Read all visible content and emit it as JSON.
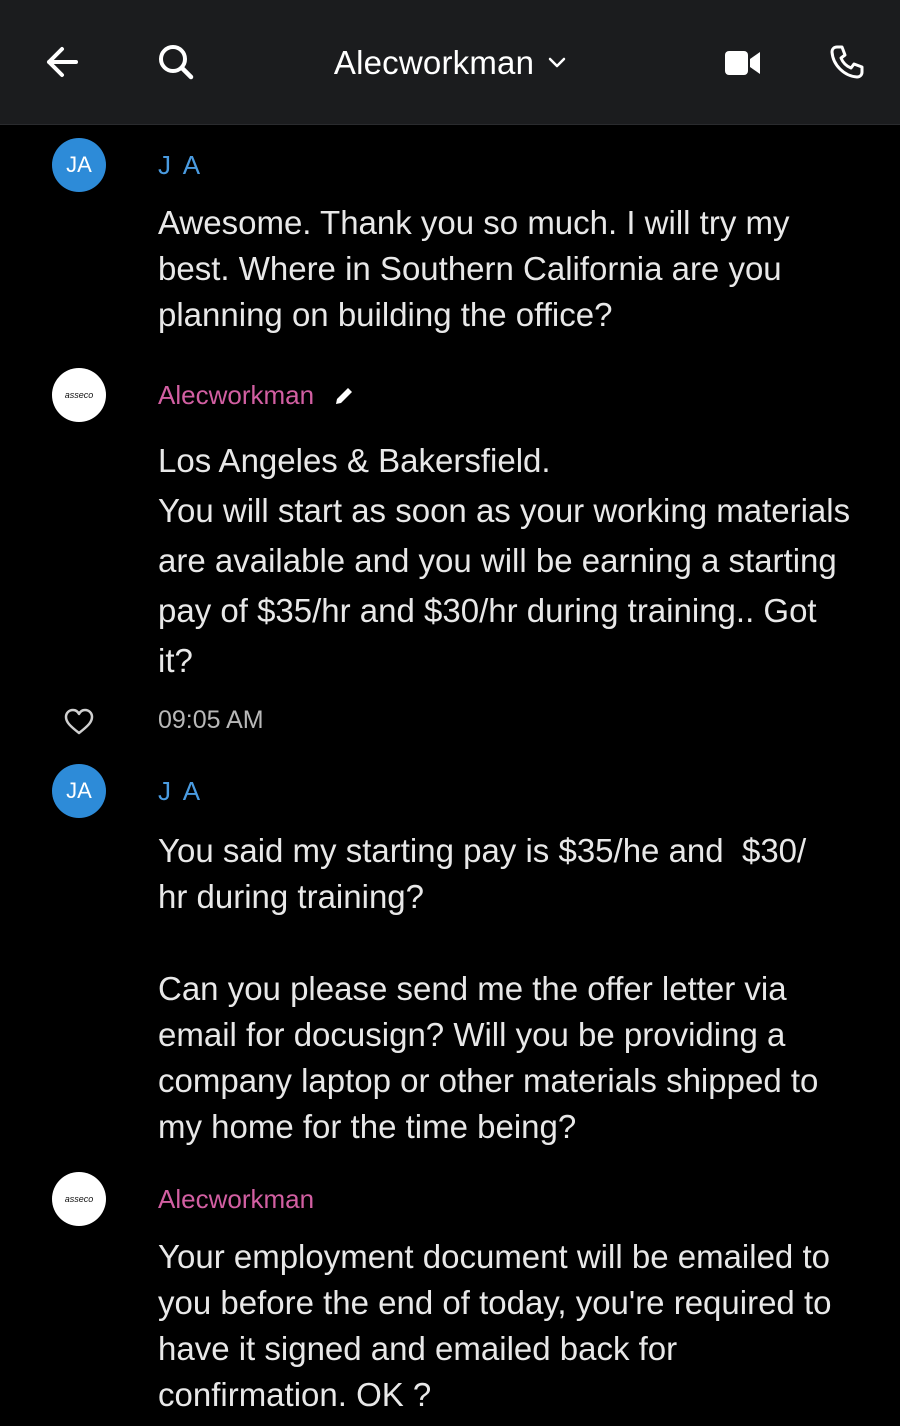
{
  "header": {
    "title": "Alecworkman",
    "back_icon": "arrow-left-icon",
    "search_icon": "search-icon",
    "dropdown_icon": "chevron-down-icon",
    "video_icon": "video-camera-icon",
    "call_icon": "phone-icon"
  },
  "colors": {
    "header_bg": "#1b1c1e",
    "background": "#000000",
    "ja_avatar": "#2d8bd8",
    "ja_name": "#4a9be0",
    "alec_name": "#d25fa2"
  },
  "messages": [
    {
      "avatar_text": "JA",
      "sender": "J A",
      "text": "Awesome. Thank you so much. I will try my best. Where in Southern California are you planning on building the office?"
    },
    {
      "avatar_logo": "asseco",
      "sender": "Alecworkman",
      "edit_icon": "pencil-icon",
      "text": "Los Angeles & Bakersfield.\nYou will start as soon as your working materials are available and you will be earning a starting pay of $35/hr and $30/hr during training.. Got it?",
      "like_icon": "heart-icon",
      "timestamp": "09:05 AM"
    },
    {
      "avatar_text": "JA",
      "sender": "J A",
      "text": "You said my starting pay is $35/he and  $30/\nhr during training?\n\nCan you please send me the offer letter via email for docusign? Will you be providing a company laptop or other materials shipped to my home for the time being?"
    },
    {
      "avatar_logo": "asseco",
      "sender": "Alecworkman",
      "text": "Your employment document will be emailed to you before the end of today, you're required to have it signed and emailed back for confirmation. OK ?"
    }
  ]
}
